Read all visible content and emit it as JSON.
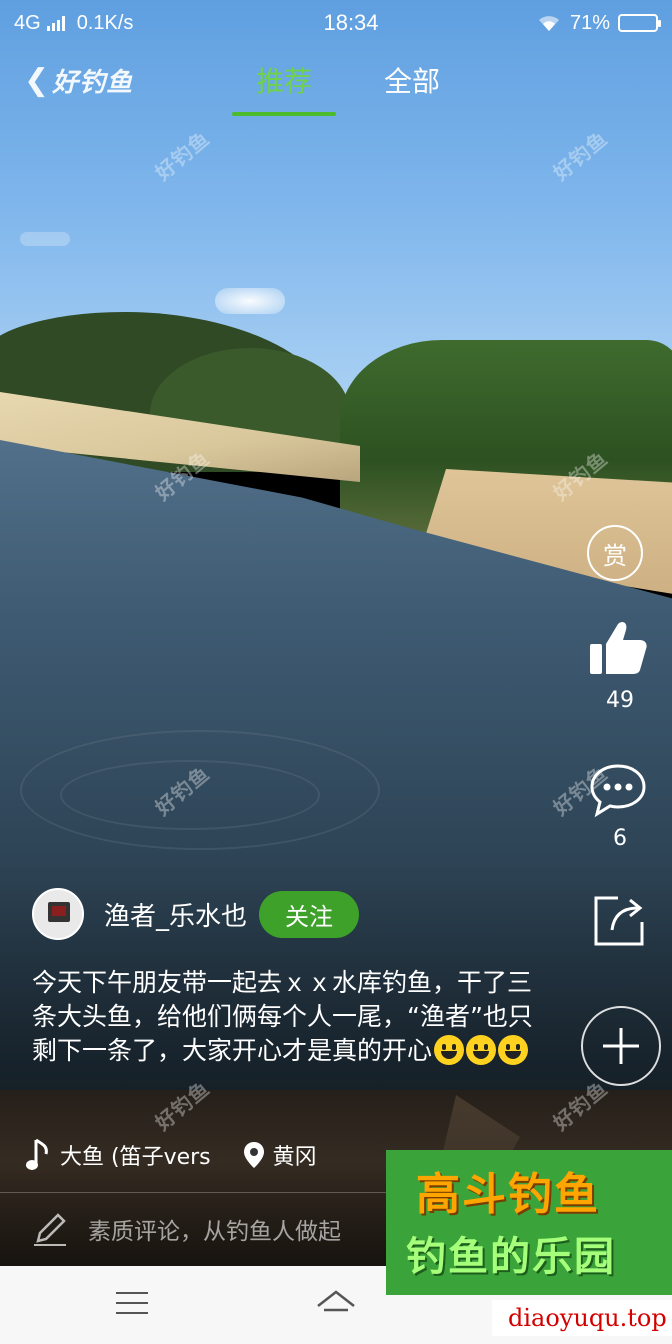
{
  "status_bar": {
    "network": "4G",
    "speed": "0.1K/s",
    "time": "18:34",
    "battery_percent": "71%",
    "battery_level": 0.71
  },
  "nav": {
    "logo": "好钓鱼",
    "tabs": [
      {
        "label": "推荐",
        "active": true
      },
      {
        "label": "全部",
        "active": false
      }
    ]
  },
  "watermark_text": "好钓鱼",
  "actions": {
    "reward_label": "赏",
    "like_count": "49",
    "comment_count": "6"
  },
  "post": {
    "author_name": "渔者_乐水也",
    "follow_label": "关注",
    "description": "今天下午朋友带一起去ｘｘ水库钓鱼，干了三条大头鱼，给他们俩每个人一尾，“渔者”也只剩下一条了，大家开心才是真的开心",
    "music": "大鱼 (笛子vers",
    "location": "黄冈"
  },
  "comment_bar": {
    "placeholder": "素质评论，从钓鱼人做起"
  },
  "promo": {
    "line1": "高斗钓鱼",
    "line2": "钓鱼的乐园",
    "url": "diaoyuqu.top"
  },
  "colors": {
    "accent_green": "#4cbb2c",
    "follow_green": "#3ea22a",
    "promo_orange": "#ffa500"
  }
}
